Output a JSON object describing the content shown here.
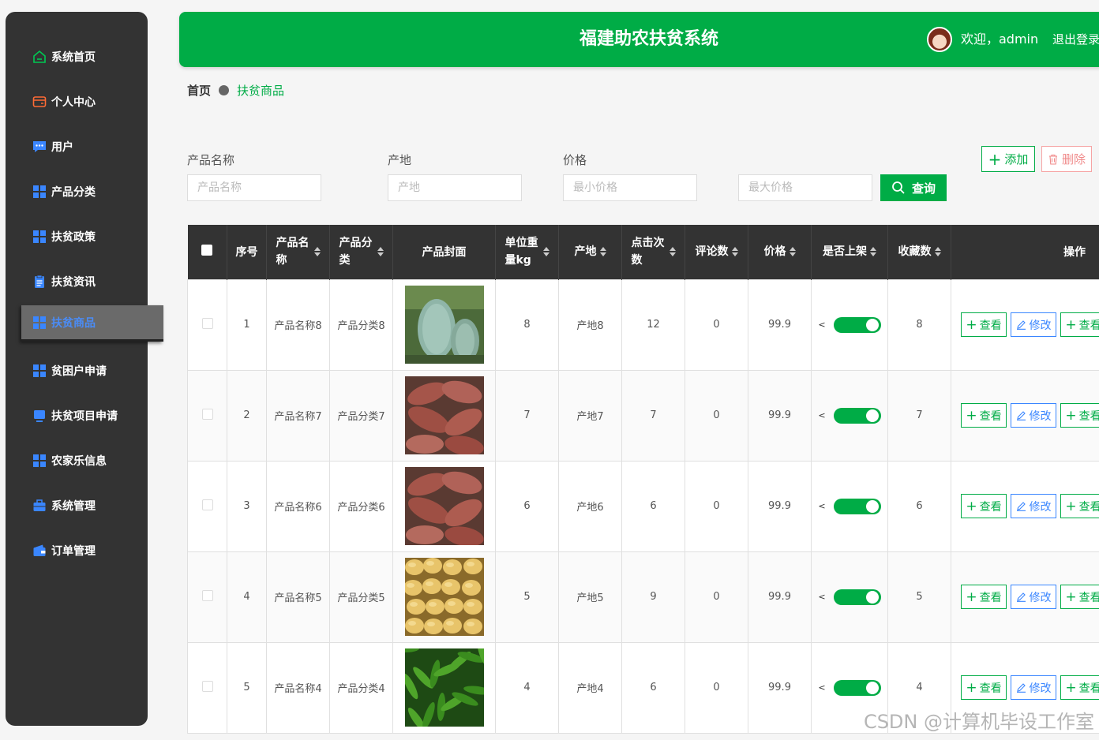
{
  "sidebar": {
    "items": [
      {
        "label": "系统首页",
        "icon": "home-icon"
      },
      {
        "label": "个人中心",
        "icon": "wallet-icon"
      },
      {
        "label": "用户",
        "icon": "chat-icon"
      },
      {
        "label": "产品分类",
        "icon": "grid-icon"
      },
      {
        "label": "扶贫政策",
        "icon": "grid-icon"
      },
      {
        "label": "扶贫资讯",
        "icon": "clipboard-icon"
      },
      {
        "label": "扶贫商品",
        "icon": "grid-icon",
        "active": true
      },
      {
        "label": "贫困户申请",
        "icon": "grid-icon"
      },
      {
        "label": "扶贫项目申请",
        "icon": "monitor-icon"
      },
      {
        "label": "农家乐信息",
        "icon": "grid-icon"
      },
      {
        "label": "系统管理",
        "icon": "briefcase-icon"
      },
      {
        "label": "订单管理",
        "icon": "wallet-icon"
      }
    ]
  },
  "header": {
    "title": "福建助农扶贫系统",
    "welcome": "欢迎，admin",
    "logout": "退出登录"
  },
  "breadcrumb": {
    "home": "首页",
    "current": "扶贫商品"
  },
  "filters": {
    "name_label": "产品名称",
    "name_placeholder": "产品名称",
    "origin_label": "产地",
    "origin_placeholder": "产地",
    "price_label": "价格",
    "min_placeholder": "最小价格",
    "max_placeholder": "最大价格",
    "query_label": "查询",
    "add_label": "添加",
    "delete_label": "删除"
  },
  "table": {
    "columns": [
      "序号",
      "产品名称",
      "产品分类",
      "产品封面",
      "单位重量kg",
      "产地",
      "点击次数",
      "评论数",
      "价格",
      "是否上架",
      "收藏数",
      "操作"
    ],
    "view_label": "查看",
    "edit_label": "修改",
    "rows": [
      {
        "index": "1",
        "name": "产品名称8",
        "category": "产品分类8",
        "cover": "winter-melon",
        "weight": "8",
        "origin": "产地8",
        "clicks": "12",
        "comments": "0",
        "price": "99.9",
        "listed": true,
        "favorites": "8"
      },
      {
        "index": "2",
        "name": "产品名称7",
        "category": "产品分类7",
        "cover": "sweet-potato",
        "weight": "7",
        "origin": "产地7",
        "clicks": "7",
        "comments": "0",
        "price": "99.9",
        "listed": true,
        "favorites": "7"
      },
      {
        "index": "3",
        "name": "产品名称6",
        "category": "产品分类6",
        "cover": "sweet-potato",
        "weight": "6",
        "origin": "产地6",
        "clicks": "6",
        "comments": "0",
        "price": "99.9",
        "listed": true,
        "favorites": "6"
      },
      {
        "index": "4",
        "name": "产品名称5",
        "category": "产品分类5",
        "cover": "potato",
        "weight": "5",
        "origin": "产地5",
        "clicks": "9",
        "comments": "0",
        "price": "99.9",
        "listed": true,
        "favorites": "5"
      },
      {
        "index": "5",
        "name": "产品名称4",
        "category": "产品分类4",
        "cover": "green-pepper",
        "weight": "4",
        "origin": "产地4",
        "clicks": "6",
        "comments": "0",
        "price": "99.9",
        "listed": true,
        "favorites": "4"
      }
    ]
  },
  "watermark": "CSDN @计算机毕设工作室",
  "colors": {
    "primary": "#00ac46",
    "sidebar": "#333333",
    "edit": "#3a86ff",
    "delete": "#f08a8a"
  }
}
